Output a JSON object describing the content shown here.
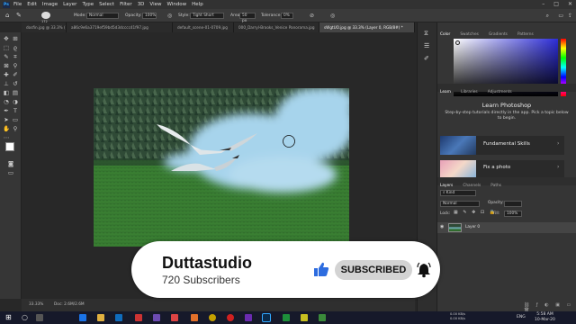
{
  "menubar": {
    "logo": "Ps",
    "items": [
      "File",
      "Edit",
      "Image",
      "Layer",
      "Type",
      "Select",
      "Filter",
      "3D",
      "View",
      "Window",
      "Help"
    ]
  },
  "options": {
    "mode_label": "Mode:",
    "mode_value": "Normal",
    "opacity_label": "Opacity:",
    "opacity_value": "100%",
    "style_label": "Style:",
    "style_value": "Tight Short",
    "area_label": "Area:",
    "area_value": "50 px",
    "tolerance_label": "Tolerance:",
    "tolerance_value": "0%",
    "brush_size": "172"
  },
  "tabs": [
    "dosfin.jpg @ 33.3% (...",
    "a86c9e6a3719ef59bd5d3dcccc41f97.jpg",
    "default_scene-01-0709.jpg",
    "000_Darryl-Brooks_Venice Panorama.jpg",
    "sWgtUO.jpg @ 33.3% (Layer 0, RGB/8#) *"
  ],
  "right_panel": {
    "top_tabs": [
      "Color",
      "Swatches",
      "Gradients",
      "Patterns"
    ],
    "mid_tabs": [
      "Learn",
      "Libraries",
      "Adjustments"
    ],
    "learn_title": "Learn Photoshop",
    "learn_text": "Step-by-step tutorials directly in the app. Pick a topic below to begin.",
    "tutorial_1": "Fundamental Skills",
    "tutorial_2": "Fix a photo",
    "layer_tabs": [
      "Layers",
      "Channels",
      "Paths"
    ],
    "kind_label": "Kind",
    "blend_value": "Normal",
    "opacity_label": "Opacity:",
    "lock_label": "Lock:",
    "fill_label": "Fill:",
    "fill_value": "100%",
    "layer_name": "Layer 0"
  },
  "status": {
    "zoom": "33.33%",
    "doc_info": "Doc: 2.6M/2.6M"
  },
  "taskbar": {
    "time": "5:58 AM",
    "date": "10-Mar-20",
    "net_up": "0.00 KB/s",
    "net_down": "0.00 KB/s",
    "lang": "ENG"
  },
  "overlay": {
    "channel": "Duttastudio",
    "subscribers": "720 Subscribers",
    "subscribe_label": "SUBSCRIBED"
  },
  "colors": {
    "accent": "#31a8ff",
    "swatch_fg": "#ffffff",
    "swatch_bg": "#1f8b96"
  }
}
